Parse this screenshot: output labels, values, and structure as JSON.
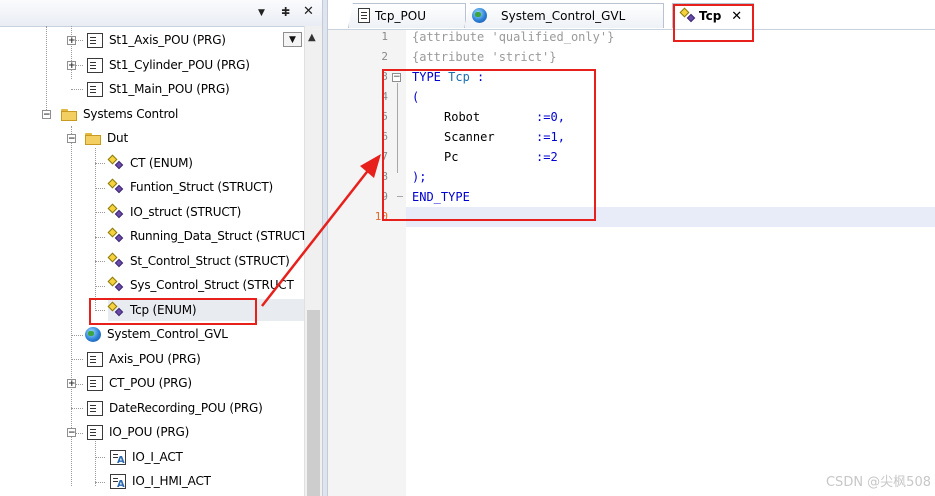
{
  "tree_panel": {
    "header_buttons": {
      "dropdown": "▼",
      "pin": "ⵐ",
      "close": "✕"
    },
    "scroll_dropdown": "▼",
    "scroll_up": "▲",
    "items": [
      {
        "label": "St1_Axis_POU (PRG)",
        "icon": "pou-icon"
      },
      {
        "label": "St1_Cylinder_POU (PRG)",
        "icon": "pou-icon"
      },
      {
        "label": "St1_Main_POU (PRG)",
        "icon": "pou-icon"
      },
      {
        "label": "Systems Control",
        "icon": "folder-icon"
      },
      {
        "label": "Dut",
        "icon": "folder-icon"
      },
      {
        "label": "CT (ENUM)",
        "icon": "dut-icon"
      },
      {
        "label": "Funtion_Struct (STRUCT)",
        "icon": "dut-icon"
      },
      {
        "label": "IO_struct (STRUCT)",
        "icon": "dut-icon"
      },
      {
        "label": "Running_Data_Struct (STRUCT",
        "icon": "dut-icon"
      },
      {
        "label": "St_Control_Struct (STRUCT)",
        "icon": "dut-icon"
      },
      {
        "label": "Sys_Control_Struct (STRUCT",
        "icon": "dut-icon"
      },
      {
        "label": "Tcp (ENUM)",
        "icon": "dut-icon"
      },
      {
        "label": "System_Control_GVL",
        "icon": "globe-icon"
      },
      {
        "label": "Axis_POU (PRG)",
        "icon": "pou-icon"
      },
      {
        "label": "CT_POU (PRG)",
        "icon": "pou-icon"
      },
      {
        "label": "DateRecording_POU (PRG)",
        "icon": "pou-icon"
      },
      {
        "label": "IO_POU (PRG)",
        "icon": "pou-icon"
      },
      {
        "label": "IO_I_ACT",
        "icon": "action-icon"
      },
      {
        "label": "IO_I_HMI_ACT",
        "icon": "action-icon"
      }
    ],
    "expanders": {
      "plus": "+",
      "minus": "−"
    }
  },
  "editor": {
    "tabs": [
      {
        "label": "Tcp_POU",
        "icon": "pou-icon"
      },
      {
        "label": "System_Control_GVL",
        "icon": "globe-icon"
      },
      {
        "label": "Tcp",
        "icon": "dut-icon",
        "active": true,
        "close": "✕"
      }
    ],
    "fold_marker": "−",
    "line_numbers": [
      "1",
      "2",
      "3",
      "4",
      "5",
      "6",
      "7",
      "8",
      "9",
      "10"
    ],
    "code": {
      "l1": "{attribute 'qualified_only'}",
      "l2": "{attribute 'strict'}",
      "l3_kw": "TYPE",
      "l3_name": "Tcp",
      "l3_colon": " :",
      "l4": "(",
      "l5_id": "Robot",
      "l5_assign": ":=",
      "l5_val": "0",
      "l5_sep": ",",
      "l6_id": "Scanner",
      "l6_assign": ":=",
      "l6_val": "1",
      "l6_sep": ",",
      "l7_id": "Pc",
      "l7_assign": ":=",
      "l7_val": "2",
      "l8": ");",
      "l9": "END_TYPE"
    }
  },
  "watermark": "CSDN @尖枫508",
  "colors": {
    "annotation": "#e8201c",
    "keyword": "#0000d0",
    "comment": "#9a9a9a"
  }
}
